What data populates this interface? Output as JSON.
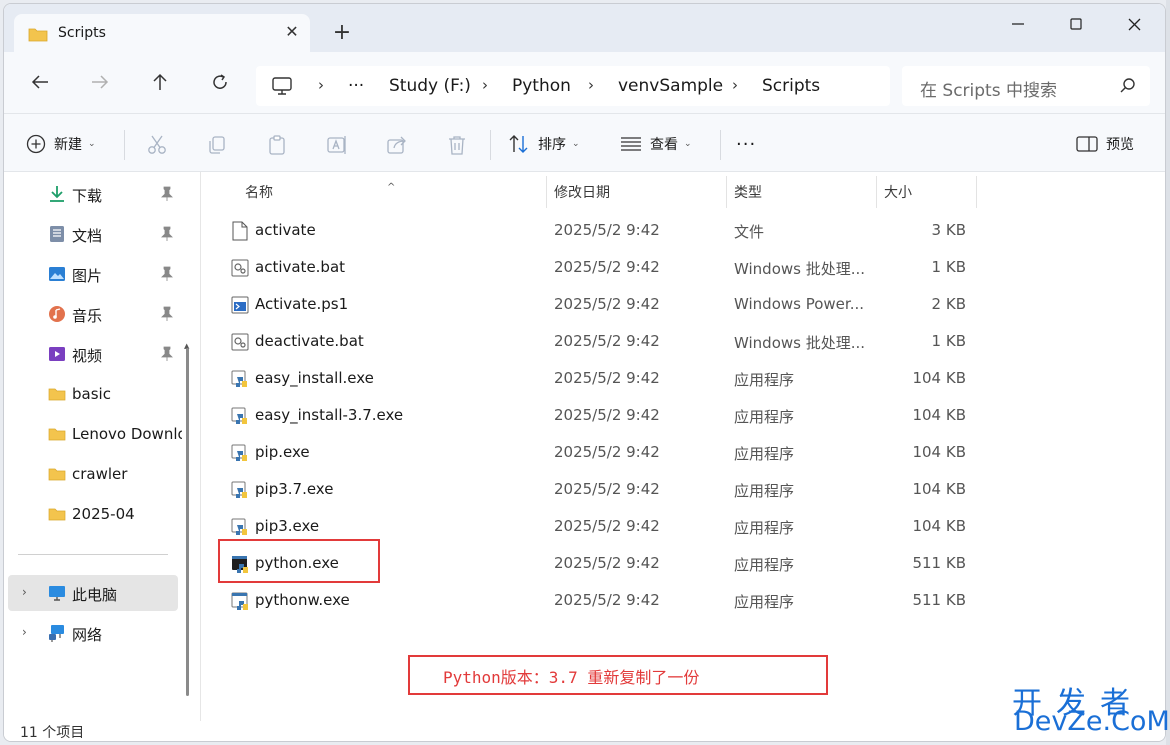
{
  "window": {
    "tab_title": "Scripts",
    "new_tab": "+"
  },
  "address": {
    "crumbs": [
      "Study (F:)",
      "Python",
      "venvSample",
      "Scripts"
    ],
    "more": "···",
    "search_placeholder": "在 Scripts 中搜索"
  },
  "toolbar": {
    "new_label": "新建",
    "sort_label": "排序",
    "view_label": "查看",
    "more": "···",
    "preview_label": "预览"
  },
  "sidebar": {
    "items": [
      {
        "label": "下载",
        "icon": "download-icon",
        "pinned": true
      },
      {
        "label": "文档",
        "icon": "document-icon",
        "pinned": true
      },
      {
        "label": "图片",
        "icon": "picture-icon",
        "pinned": true
      },
      {
        "label": "音乐",
        "icon": "music-icon",
        "pinned": true
      },
      {
        "label": "视频",
        "icon": "video-icon",
        "pinned": true
      },
      {
        "label": "basic",
        "icon": "folder-icon"
      },
      {
        "label": "Lenovo Downloads",
        "icon": "folder-icon"
      },
      {
        "label": "crawler",
        "icon": "folder-icon"
      },
      {
        "label": "2025-04",
        "icon": "folder-icon"
      }
    ],
    "this_pc": "此电脑",
    "network": "网络"
  },
  "columns": {
    "name": "名称",
    "date": "修改日期",
    "type": "类型",
    "size": "大小"
  },
  "files": [
    {
      "name": "activate",
      "date": "2025/5/2 9:42",
      "type": "文件",
      "size": "3 KB",
      "icon": "file-icon"
    },
    {
      "name": "activate.bat",
      "date": "2025/5/2 9:42",
      "type": "Windows 批处理...",
      "size": "1 KB",
      "icon": "batch-file-icon"
    },
    {
      "name": "Activate.ps1",
      "date": "2025/5/2 9:42",
      "type": "Windows Power...",
      "size": "2 KB",
      "icon": "powershell-file-icon"
    },
    {
      "name": "deactivate.bat",
      "date": "2025/5/2 9:42",
      "type": "Windows 批处理...",
      "size": "1 KB",
      "icon": "batch-file-icon"
    },
    {
      "name": "easy_install.exe",
      "date": "2025/5/2 9:42",
      "type": "应用程序",
      "size": "104 KB",
      "icon": "python-exe-icon"
    },
    {
      "name": "easy_install-3.7.exe",
      "date": "2025/5/2 9:42",
      "type": "应用程序",
      "size": "104 KB",
      "icon": "python-exe-icon"
    },
    {
      "name": "pip.exe",
      "date": "2025/5/2 9:42",
      "type": "应用程序",
      "size": "104 KB",
      "icon": "python-exe-icon"
    },
    {
      "name": "pip3.7.exe",
      "date": "2025/5/2 9:42",
      "type": "应用程序",
      "size": "104 KB",
      "icon": "python-exe-icon"
    },
    {
      "name": "pip3.exe",
      "date": "2025/5/2 9:42",
      "type": "应用程序",
      "size": "104 KB",
      "icon": "python-exe-icon"
    },
    {
      "name": "python.exe",
      "date": "2025/5/2 9:42",
      "type": "应用程序",
      "size": "511 KB",
      "icon": "python-console-icon"
    },
    {
      "name": "pythonw.exe",
      "date": "2025/5/2 9:42",
      "type": "应用程序",
      "size": "511 KB",
      "icon": "python-window-icon"
    }
  ],
  "annotation": "Python版本：3.7  重新复制了一份",
  "status": "11 个项目",
  "watermark": {
    "line1": "开发者",
    "line2": "DevZe.CoM"
  }
}
